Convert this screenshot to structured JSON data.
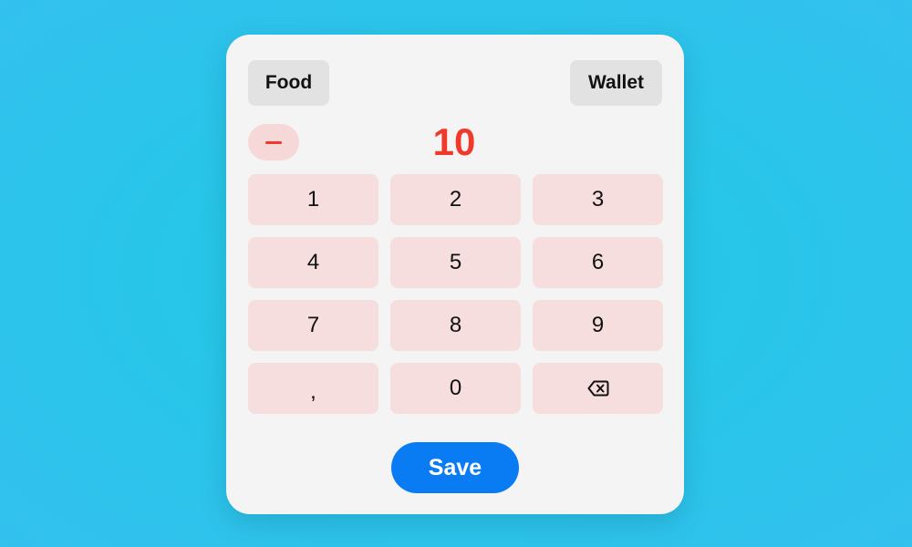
{
  "colors": {
    "background": "#2ac6ea",
    "card": "#f4f4f4",
    "accent_red": "#ef3a2b",
    "key_bg": "#f6dede",
    "save_bg": "#0a7cf3"
  },
  "header": {
    "category_label": "Food",
    "account_label": "Wallet"
  },
  "amount": {
    "sign_icon": "minus-icon",
    "value": "10"
  },
  "keypad": {
    "keys": [
      "1",
      "2",
      "3",
      "4",
      "5",
      "6",
      "7",
      "8",
      "9",
      ",",
      "0"
    ],
    "backspace_icon": "backspace-icon"
  },
  "footer": {
    "save_label": "Save"
  }
}
